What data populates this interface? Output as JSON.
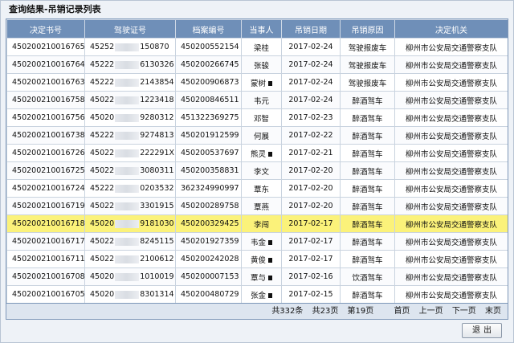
{
  "window": {
    "title": "查询结果-吊销记录列表"
  },
  "table": {
    "columns": [
      "决定书号",
      "驾驶证号",
      "档案编号",
      "当事人",
      "吊销日期",
      "吊销原因",
      "决定机关"
    ],
    "selected_index": 7,
    "rows": [
      {
        "decision_no": "450200210016765",
        "license_prefix": "45252",
        "license_suffix": "150870",
        "file_no": "450200552154",
        "party": "梁桂",
        "date": "2017-02-24",
        "reason": "驾驶报废车",
        "authority": "柳州市公安局交通警察支队"
      },
      {
        "decision_no": "450200210016764",
        "license_prefix": "45222",
        "license_suffix": "6130326",
        "file_no": "450200266745",
        "party": "张骏",
        "date": "2017-02-24",
        "reason": "驾驶报废车",
        "authority": "柳州市公安局交通警察支队"
      },
      {
        "decision_no": "450200210016763",
        "license_prefix": "45222",
        "license_suffix": "2143854",
        "file_no": "450200906873",
        "party": "蒙树",
        "date": "2017-02-24",
        "reason": "驾驶报废车",
        "authority": "柳州市公安局交通警察支队"
      },
      {
        "decision_no": "450200210016758",
        "license_prefix": "45022",
        "license_suffix": "1223418",
        "file_no": "450200846511",
        "party": "韦元",
        "date": "2017-02-24",
        "reason": "醉酒驾车",
        "authority": "柳州市公安局交通警察支队"
      },
      {
        "decision_no": "450200210016756",
        "license_prefix": "45020",
        "license_suffix": "9280312",
        "file_no": "451322369275",
        "party": "邓智",
        "date": "2017-02-23",
        "reason": "醉酒驾车",
        "authority": "柳州市公安局交通警察支队"
      },
      {
        "decision_no": "450200210016738",
        "license_prefix": "45222",
        "license_suffix": "9274813",
        "file_no": "450201912599",
        "party": "何展",
        "date": "2017-02-22",
        "reason": "醉酒驾车",
        "authority": "柳州市公安局交通警察支队"
      },
      {
        "decision_no": "450200210016726",
        "license_prefix": "45022",
        "license_suffix": "222291X",
        "file_no": "450200537697",
        "party": "熊灵",
        "date": "2017-02-21",
        "reason": "醉酒驾车",
        "authority": "柳州市公安局交通警察支队"
      },
      {
        "decision_no": "450200210016725",
        "license_prefix": "45022",
        "license_suffix": "3080311",
        "file_no": "450200358831",
        "party": "李文",
        "date": "2017-02-20",
        "reason": "醉酒驾车",
        "authority": "柳州市公安局交通警察支队"
      },
      {
        "decision_no": "450200210016724",
        "license_prefix": "45222",
        "license_suffix": "0203532",
        "file_no": "362324990997",
        "party": "覃东",
        "date": "2017-02-20",
        "reason": "醉酒驾车",
        "authority": "柳州市公安局交通警察支队"
      },
      {
        "decision_no": "450200210016719",
        "license_prefix": "45022",
        "license_suffix": "3301915",
        "file_no": "450200289758",
        "party": "覃燕",
        "date": "2017-02-20",
        "reason": "醉酒驾车",
        "authority": "柳州市公安局交通警察支队"
      },
      {
        "decision_no": "450200210016718",
        "license_prefix": "45020",
        "license_suffix": "9181030",
        "file_no": "450200329425",
        "party": "李闯",
        "date": "2017-02-17",
        "reason": "醉酒驾车",
        "authority": "柳州市公安局交通警察支队"
      },
      {
        "decision_no": "450200210016717",
        "license_prefix": "45022",
        "license_suffix": "8245115",
        "file_no": "450201927359",
        "party": "韦金",
        "date": "2017-02-17",
        "reason": "醉酒驾车",
        "authority": "柳州市公安局交通警察支队"
      },
      {
        "decision_no": "450200210016711",
        "license_prefix": "45022",
        "license_suffix": "2100612",
        "file_no": "450200242028",
        "party": "黄俊",
        "date": "2017-02-17",
        "reason": "醉酒驾车",
        "authority": "柳州市公安局交通警察支队"
      },
      {
        "decision_no": "450200210016708",
        "license_prefix": "45020",
        "license_suffix": "1010019",
        "file_no": "450200007153",
        "party": "覃与",
        "date": "2017-02-16",
        "reason": "饮酒驾车",
        "authority": "柳州市公安局交通警察支队"
      },
      {
        "decision_no": "450200210016705",
        "license_prefix": "45020",
        "license_suffix": "8301314",
        "file_no": "450200480729",
        "party": "张金",
        "date": "2017-02-15",
        "reason": "醉酒驾车",
        "authority": "柳州市公安局交通警察支队"
      }
    ]
  },
  "status": {
    "total_records": "共332条",
    "total_pages": "共23页",
    "current_page": "第19页",
    "first_page": "首页",
    "prev_page": "上一页",
    "next_page": "下一页",
    "last_page": "末页"
  },
  "buttons": {
    "exit_label": "退出"
  }
}
